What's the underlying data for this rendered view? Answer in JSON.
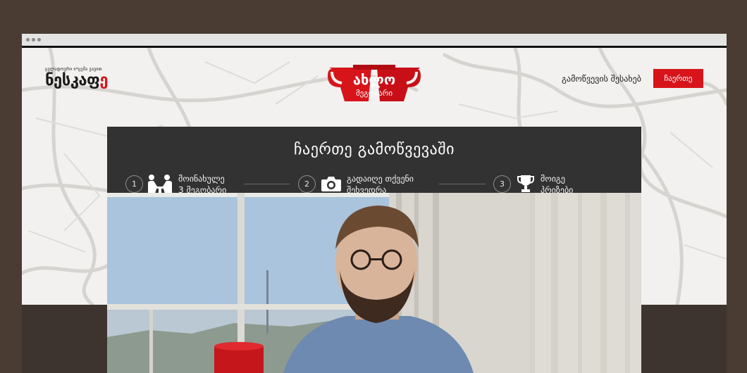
{
  "window": {
    "controls": [
      "dot",
      "dot",
      "dot"
    ]
  },
  "brand_left": {
    "tagline": "ცვლადოვრი ი*ცემა ვავით",
    "name_prefix": "ნესკაფ",
    "name_suffix": "ე"
  },
  "brand_center": {
    "line1": "ახლო",
    "line2": "მეგობარი"
  },
  "nav": {
    "about_label": "გამოწვევის შესახებ",
    "join_label": "ჩაერთე"
  },
  "panel": {
    "title": "ჩაერთე გამოწვევაში",
    "steps": [
      {
        "number": "1",
        "icon": "friends-icon",
        "line1": "მოინახულე",
        "line2": "3 მეგობარი"
      },
      {
        "number": "2",
        "icon": "camera-icon",
        "line1": "გადაიღე თქვენი",
        "line2": "შეხვედრა"
      },
      {
        "number": "3",
        "icon": "trophy-icon",
        "line1": "მოიგე",
        "line2": "პრიზები"
      }
    ]
  },
  "colors": {
    "brand_red": "#d8141b",
    "panel_bg": "#333232",
    "outer_bg": "#4a3c33"
  }
}
